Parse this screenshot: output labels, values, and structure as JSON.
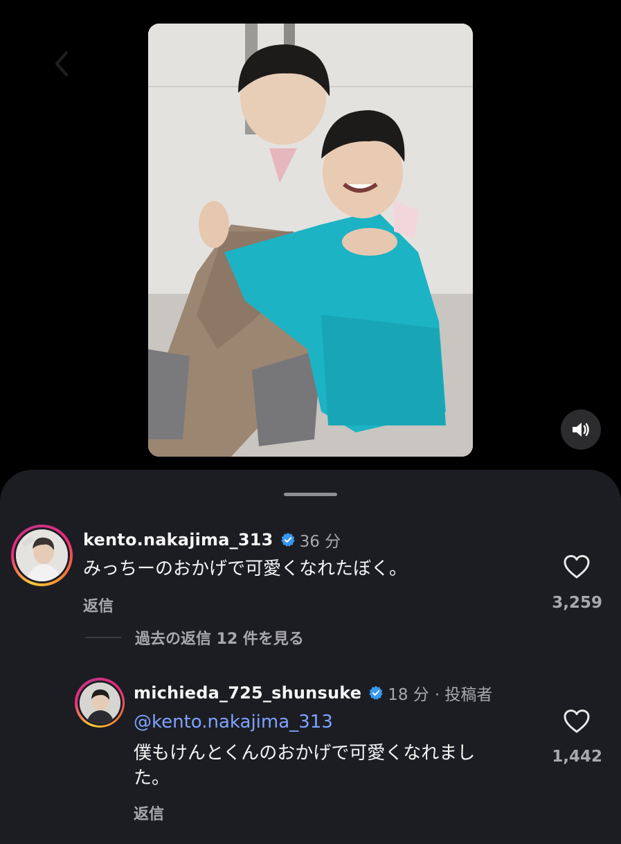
{
  "icons": {
    "back": "chevron-left-icon",
    "mute": "speaker-icon",
    "verified": "verified-badge-icon",
    "like": "heart-outline-icon"
  },
  "colors": {
    "background": "#000000",
    "sheet": "#1c1d22",
    "verified": "#3897f0",
    "mention": "#7ea3ff",
    "muted_text": "#a8a8ad"
  },
  "comments": [
    {
      "username": "kento.nakajima_313",
      "verified": true,
      "time": "36 分",
      "text": "みっちーのおかげで可愛くなれたぼく。",
      "reply_label": "返信",
      "likes": "3,259",
      "view_replies": "過去の返信 12 件を見る"
    },
    {
      "username": "michieda_725_shunsuke",
      "verified": true,
      "time": "18 分",
      "author_tag": "· 投稿者",
      "mention": "@kento.nakajima_313",
      "text_line1": "僕もけんとくんのおかげで可愛くなれまし",
      "text_line2": "た。",
      "reply_label": "返信",
      "likes": "1,442"
    }
  ]
}
